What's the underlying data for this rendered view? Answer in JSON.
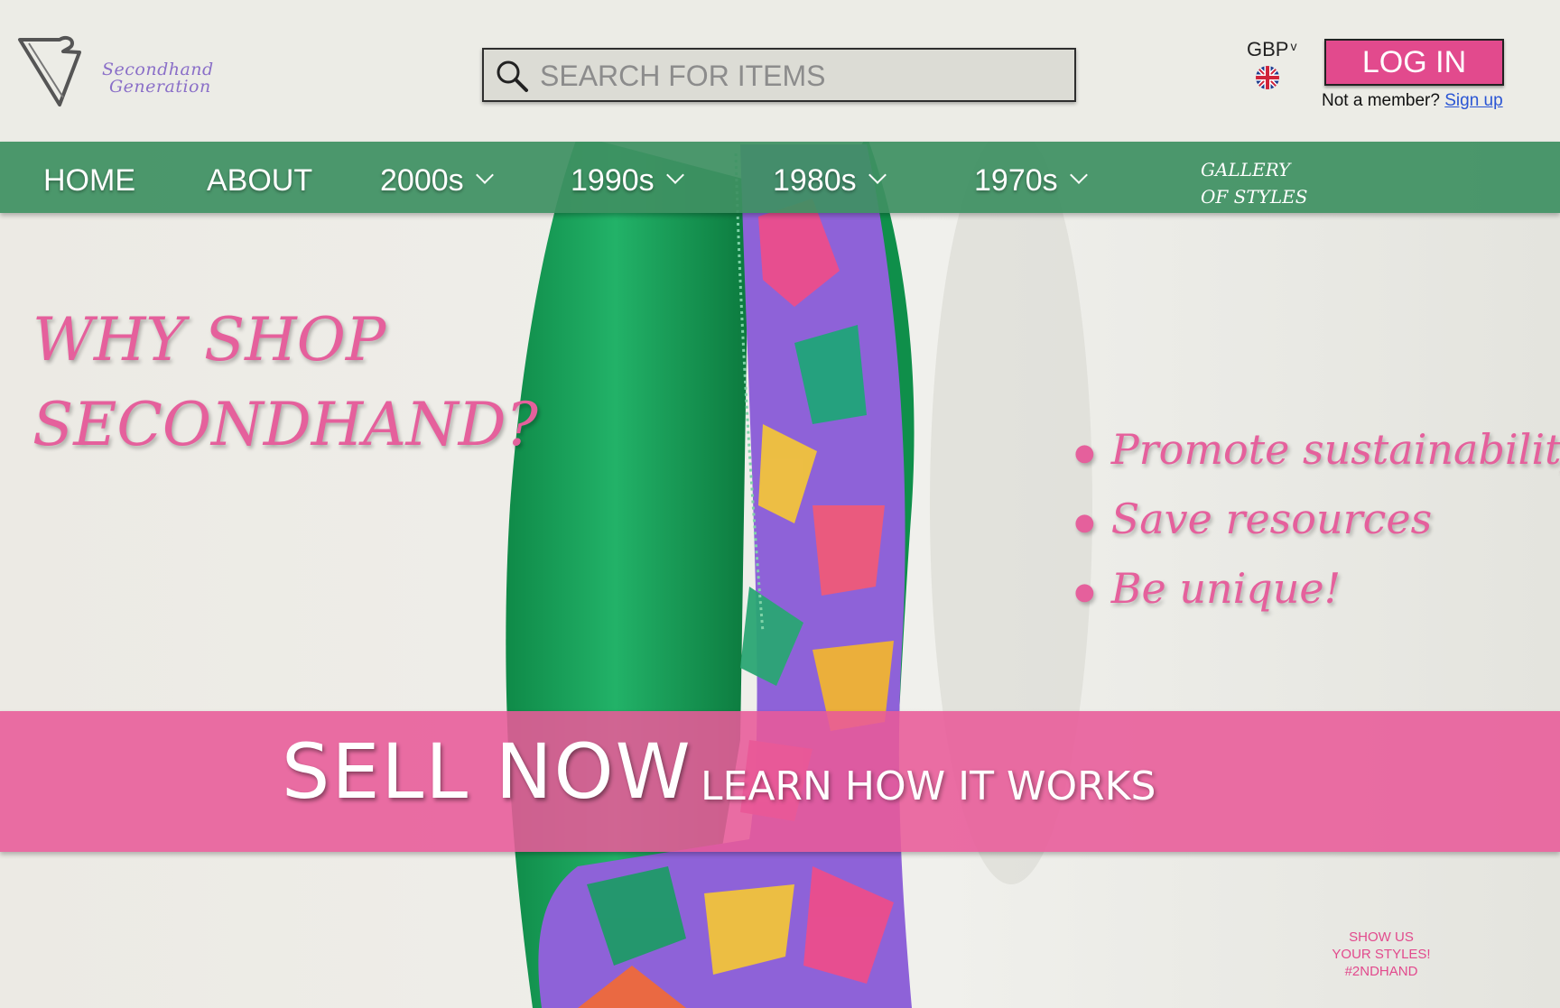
{
  "brand": {
    "line1": "Secondhand",
    "line2": "Generation",
    "accent": "#8a6fc8"
  },
  "search": {
    "placeholder": "SEARCH FOR ITEMS",
    "icon": "search-icon"
  },
  "account": {
    "currency": "GBP",
    "flag_icon": "uk-flag-icon",
    "login_label": "LOG IN",
    "member_prompt": "Not a member?",
    "signup_label": "Sign up"
  },
  "nav": {
    "items": [
      {
        "label": "HOME",
        "dropdown": false
      },
      {
        "label": "ABOUT",
        "dropdown": false
      },
      {
        "label": "2000s",
        "dropdown": true
      },
      {
        "label": "1990s",
        "dropdown": true
      },
      {
        "label": "1980s",
        "dropdown": true
      },
      {
        "label": "1970s",
        "dropdown": true
      }
    ],
    "gallery_line1": "GALLERY",
    "gallery_line2": "OF STYLES",
    "bar_color": "#3e9062"
  },
  "hero": {
    "headline_line1": "WHY SHOP",
    "headline_line2": "SECONDHAND?",
    "benefits": [
      "Promote sustainability",
      "Save resources",
      "Be unique!"
    ],
    "text_color": "#e5609c"
  },
  "banner": {
    "sell_label": "SELL NOW",
    "learn_label": "LEARN HOW IT WORKS",
    "color": "#e85a98"
  },
  "footer": {
    "share_line1": "SHOW US",
    "share_line2": "YOUR STYLES!",
    "share_line3": "#2NDHAND"
  }
}
